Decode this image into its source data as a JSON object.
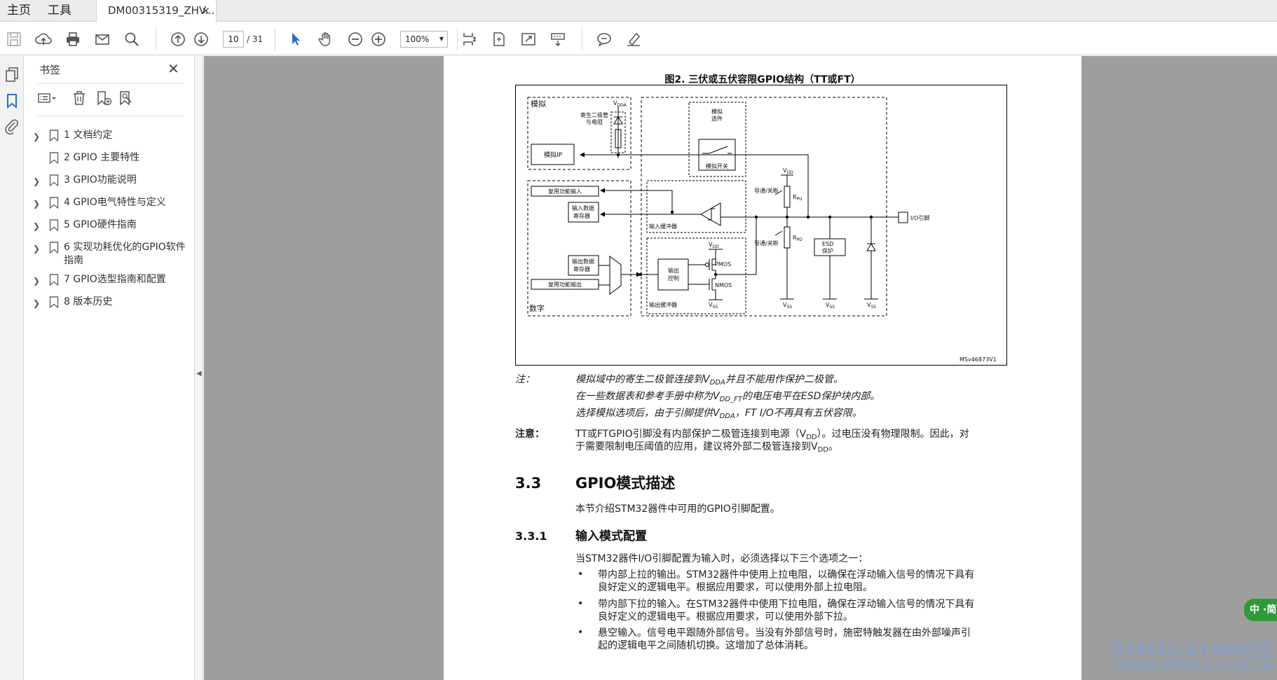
{
  "menu": {
    "home": "主页",
    "tools": "工具"
  },
  "document_tab": {
    "title": "DM00315319_ZHV...",
    "close": "×"
  },
  "toolbar": {
    "page_current": "10",
    "page_total": "/ 31",
    "zoom": "100%"
  },
  "bookmarks": {
    "title": "书签",
    "close": "✕",
    "items": [
      {
        "label": "1 文档约定",
        "expandable": true
      },
      {
        "label": "2 GPIO 主要特性",
        "expandable": false
      },
      {
        "label": "3 GPIO功能说明",
        "expandable": true
      },
      {
        "label": "4 GPIO电气特性与定义",
        "expandable": true
      },
      {
        "label": "5 GPIO硬件指南",
        "expandable": true
      },
      {
        "label": "6 实现功耗优化的GPIO软件指南",
        "expandable": true
      },
      {
        "label": "7 GPIO选型指南和配置",
        "expandable": true
      },
      {
        "label": "8 版本历史",
        "expandable": true
      }
    ]
  },
  "page": {
    "figure_title": "图2. 三伏或五伏容限GPIO结构（TT或FT）",
    "figure": {
      "analog": "模拟",
      "parasitic": "寄生二极管",
      "parasitic2": "与电阻",
      "vdda": "V",
      "vdda_sub": "DDA",
      "analog_ip": "模拟IP",
      "analog_option": "模拟",
      "analog_option2": "选件",
      "analog_switch": "模拟开关",
      "alt_in": "复用功能输入",
      "in_data_reg": "输入数据",
      "in_data_reg2": "寄存器",
      "in_buffer": "输入缓冲器",
      "out_data_reg": "输出数据",
      "out_data_reg2": "寄存器",
      "alt_out": "复用功能输出",
      "digital": "数字",
      "out_ctrl": "输出",
      "out_ctrl2": "控制",
      "pmos": "PMOS",
      "nmos": "NMOS",
      "out_buffer": "输出缓冲器",
      "on_off_1": "导通/关断",
      "on_off_2": "导通/关断",
      "rpu": "R",
      "rpu_sub": "PU",
      "rpd": "R",
      "rpd_sub": "PD",
      "vdd": "V",
      "vdd_sub": "DD",
      "vss": "V",
      "vss_sub": "SS",
      "esd": "ESD",
      "esd2": "保护",
      "io_pin": "I/O引脚",
      "ref": "MSv46873V1"
    },
    "note_label": "注：",
    "notes": [
      {
        "pre": "模拟域中的寄生二极管连接到V",
        "sub": "DDA",
        "post": "并且不能用作保护二极管。"
      },
      {
        "pre": "在一些数据表和参考手册中称为V",
        "sub": "DD_FT",
        "post": "的电压电平在ESD保护块内部。"
      },
      {
        "pre": "选择模拟选项后，由于引脚提供V",
        "sub": "DDA",
        "post": "，FT I/O不再具有五伏容限。"
      }
    ],
    "caution_label": "注意：",
    "caution_line1_pre": "TT或FTGPIO引脚没有内部保护二极管连接到电源（V",
    "caution_line1_sub": "DD",
    "caution_line1_post": "）。过电压没有物理限制。因此，对",
    "caution_line2_pre": "于需要限制电压阈值的应用，建议将外部二极管连接到V",
    "caution_line2_sub": "DD",
    "caution_line2_post": "。",
    "section_33_num": "3.3",
    "section_33_title": "GPIO模式描述",
    "section_33_body": "本节介绍STM32器件中可用的GPIO引脚配置。",
    "section_331_num": "3.3.1",
    "section_331_title": "输入模式配置",
    "section_331_intro": "当STM32器件I/O引脚配置为输入时，必须选择以下三个选项之一：",
    "bullet_char": "•",
    "bullets": [
      {
        "line1": "带内部上拉的输出。STM32器件中使用上拉电阻，以确保在浮动输入信号的情况下具有",
        "line2": "良好定义的逻辑电平。根据应用要求，可以使用外部上拉电阻。"
      },
      {
        "line1": "带内部下拉的输入。在STM32器件中使用下拉电阻，确保在浮动输入信号的情况下具有",
        "line2": "良好定义的逻辑电平。根据应用要求，可以使用外部下拉。"
      },
      {
        "line1": "悬空输入。信号电平跟随外部信号。当没有外部信号时，施密特触发器在由外部噪声引",
        "line2": "起的逻辑电平之间随机切换。这增加了总体消耗。"
      }
    ]
  },
  "translate_widget": "中 ·简",
  "watermark": {
    "line1": "STM32/STM8社区",
    "line2": "www.stmcu.org.cn"
  },
  "colors": {
    "accent_blue": "#2a6fd6",
    "widget_green": "#2e9a3a",
    "doc_bg": "#9e9e9e"
  }
}
